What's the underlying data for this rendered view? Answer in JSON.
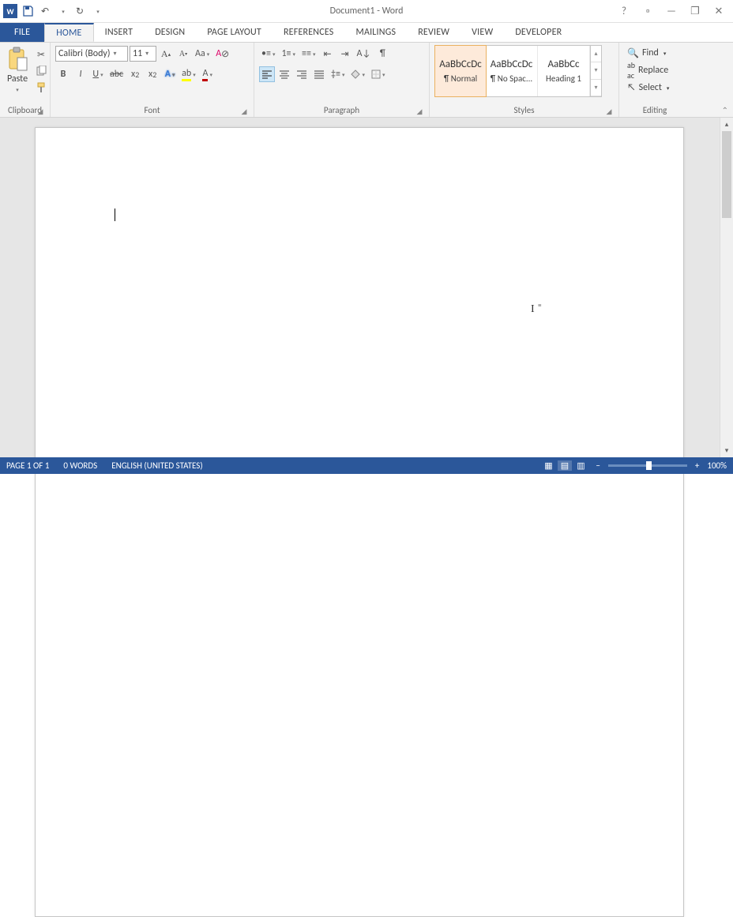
{
  "title": "Document1 - Word",
  "tabs": [
    "FILE",
    "HOME",
    "INSERT",
    "DESIGN",
    "PAGE LAYOUT",
    "REFERENCES",
    "MAILINGS",
    "REVIEW",
    "VIEW",
    "DEVELOPER"
  ],
  "activeTab": "HOME",
  "clipboard": {
    "label": "Clipboard",
    "paste": "Paste"
  },
  "font": {
    "label": "Font",
    "name": "Calibri (Body)",
    "size": "11"
  },
  "paragraph": {
    "label": "Paragraph"
  },
  "styles": {
    "label": "Styles",
    "items": [
      {
        "preview": "AaBbCcDc",
        "name": "¶ Normal"
      },
      {
        "preview": "AaBbCcDc",
        "name": "¶ No Spac..."
      },
      {
        "preview": "AaBbCc",
        "name": "Heading 1"
      }
    ]
  },
  "editing": {
    "label": "Editing",
    "find": "Find",
    "replace": "Replace",
    "select": "Select"
  },
  "status": {
    "page": "PAGE 1 OF 1",
    "words": "0 WORDS",
    "language": "ENGLISH (UNITED STATES)",
    "zoom": "100%"
  }
}
